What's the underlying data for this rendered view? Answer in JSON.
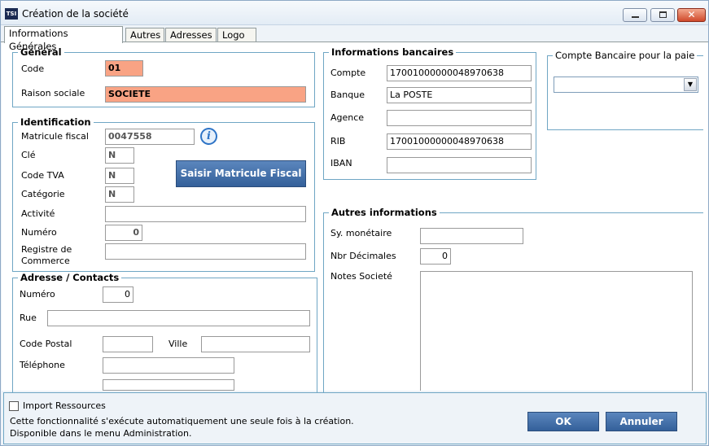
{
  "window": {
    "app_icon": "TSI",
    "title": "Création de la société",
    "minimize_glyph": "",
    "maximize_glyph": "",
    "close_glyph": "✕"
  },
  "tabs": [
    {
      "label": "Informations Générales"
    },
    {
      "label": "Autres"
    },
    {
      "label": "Adresses"
    },
    {
      "label": "Logo"
    }
  ],
  "general": {
    "legend": "Général",
    "code_label": "Code",
    "code_value": "01",
    "raison_label": "Raison sociale",
    "raison_value": "SOCIETE"
  },
  "identification": {
    "legend": "Identification",
    "matricule_label": "Matricule fiscal",
    "matricule_value": "0047558",
    "cle_label": "Clé",
    "cle_value": "N",
    "code_tva_label": "Code TVA",
    "code_tva_value": "N",
    "categorie_label": "Catégorie",
    "categorie_value": "N",
    "activite_label": "Activité",
    "activite_value": "",
    "numero_etab_label": "Numéro",
    "numero_etab_value": "0",
    "registre_label_1": "Registre de",
    "registre_label_2": "Commerce",
    "registre_value": "",
    "saisir_button": "Saisir Matricule Fiscal",
    "info_glyph": "i"
  },
  "adresse": {
    "legend": "Adresse / Contacts",
    "numero_label": "Numéro",
    "numero_value": "0",
    "rue_label": "Rue",
    "rue_value": "",
    "code_postal_label": "Code Postal",
    "code_postal_value": "",
    "ville_label": "Ville",
    "ville_value": "",
    "telephone_label": "Téléphone",
    "telephone_value": ""
  },
  "bancaires": {
    "legend": "Informations bancaires",
    "compte_label": "Compte",
    "compte_value": "17001000000048970638",
    "banque_label": "Banque",
    "banque_value": "La POSTE",
    "agence_label": "Agence",
    "agence_value": "",
    "rib_label": "RIB",
    "rib_value": "17001000000048970638",
    "iban_label": "IBAN",
    "iban_value": ""
  },
  "compte_paie": {
    "legend": "Compte Bancaire pour la paie",
    "selected": "",
    "arrow_glyph": "▼"
  },
  "autres": {
    "legend": "Autres informations",
    "sy_monetaire_label": "Sy.  monétaire",
    "sy_monetaire_value": "",
    "nbr_decimales_label": "Nbr Décimales",
    "nbr_decimales_value": "0",
    "notes_label": "Notes Societé",
    "notes_value": ""
  },
  "footer": {
    "import_label": "Import Ressources",
    "line1": "Cette fonctionnalité s'exécute automatiquement une seule fois à la création.",
    "line2": "Disponible dans le menu Administration.",
    "ok_button": "OK",
    "annuler_button": "Annuler"
  },
  "colors": {
    "required_field": "#f9a384",
    "group_border": "#6fa6c4",
    "button": "#3f6ba4"
  }
}
